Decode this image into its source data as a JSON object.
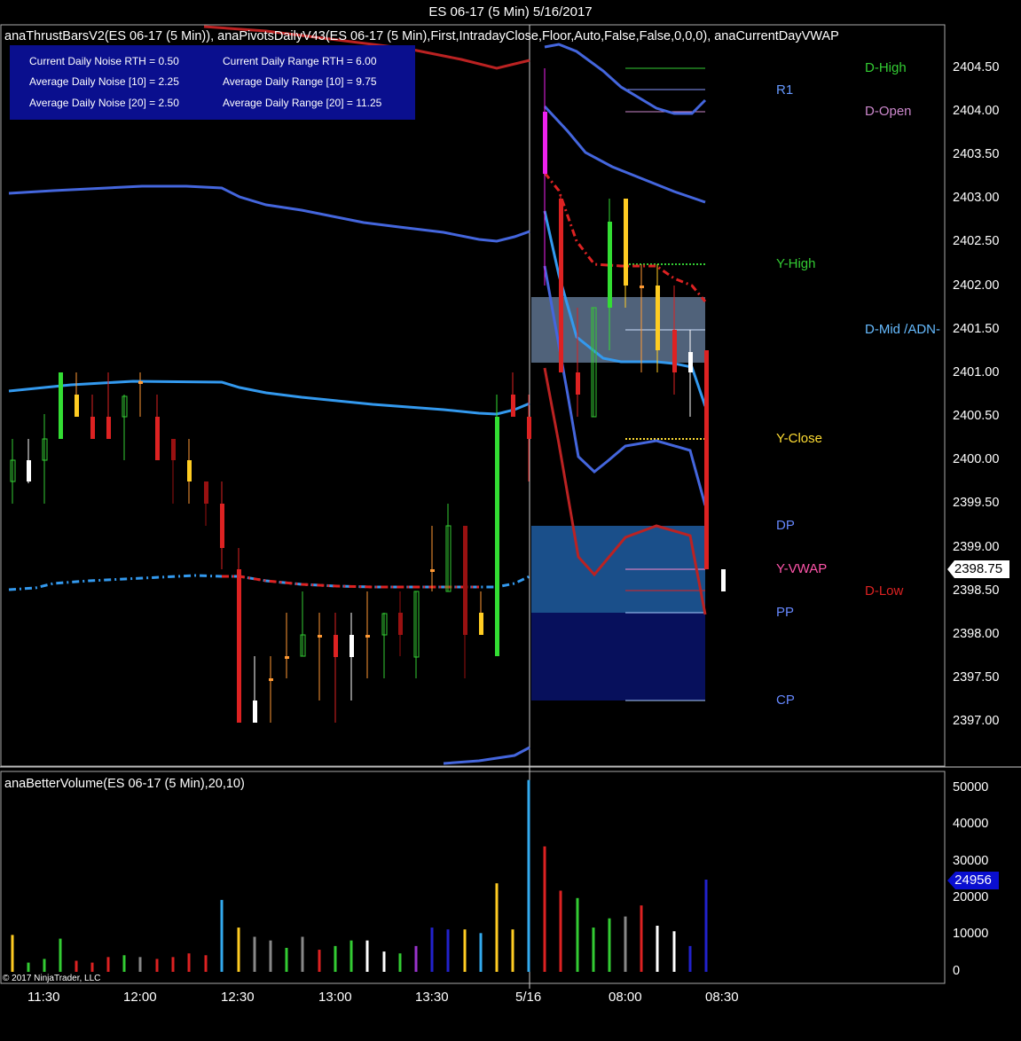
{
  "window": {
    "title": "ES 06-17 (5 Min)  5/16/2017"
  },
  "price_panel": {
    "indicator_label": "anaThrustBarsV2(ES 06-17  (5 Min)),  anaPivotsDailyV43(ES 06-17  (5 Min),First,IntradayClose,Floor,Auto,False,False,0,0,0),  anaCurrentDayVWAP",
    "stats": {
      "noise_rth": "Current Daily Noise RTH = 0.50",
      "range_rth": "Current Daily Range RTH = 6.00",
      "noise_10": "Average Daily Noise [10] = 2.25",
      "range_10": "Average Daily Range [10] = 9.75",
      "noise_20": "Average Daily Noise [20] = 2.50",
      "range_20": "Average Daily Range [20] = 11.25"
    },
    "price_axis": [
      "2404.50",
      "2404.00",
      "2403.50",
      "2403.00",
      "2402.50",
      "2402.00",
      "2401.50",
      "2401.00",
      "2400.50",
      "2400.00",
      "2399.50",
      "2399.00",
      "2398.50",
      "2398.00",
      "2397.50",
      "2397.00"
    ],
    "last_price": "2398.75",
    "levels": {
      "d_high": "D-High",
      "r1": "R1",
      "d_open": "D-Open",
      "y_high": "Y-High",
      "d_mid": "D-Mid /ADN-",
      "y_close": "Y-Close",
      "dp": "DP",
      "y_vwap": "Y-VWAP",
      "d_low": "D-Low",
      "pp": "PP",
      "cp": "CP"
    },
    "colors": {
      "d_high": "#33cc33",
      "r1": "#6699ff",
      "d_open": "#cc88cc",
      "y_high": "#33cc33",
      "d_mid": "#66bbff",
      "y_close": "#ffdd33",
      "dp": "#6688ff",
      "y_vwap": "#ff55aa",
      "d_low": "#dd2222",
      "pp": "#6688ff",
      "cp": "#6688ff"
    }
  },
  "volume_panel": {
    "indicator_label": "anaBetterVolume(ES 06-17 (5 Min),20,10)",
    "volume_axis": [
      "50000",
      "40000",
      "30000",
      "20000",
      "10000",
      "0"
    ],
    "last_volume": "24956"
  },
  "time_axis": [
    "11:30",
    "12:00",
    "12:30",
    "13:00",
    "13:30",
    "5/16",
    "08:00",
    "08:30"
  ],
  "copyright": "© 2017 NinjaTrader, LLC",
  "chart_data": {
    "type": "candlestick",
    "volume_values": [
      10000,
      2500,
      3500,
      9000,
      3000,
      2500,
      4000,
      4500,
      4000,
      3500,
      4000,
      5000,
      4500,
      19500,
      12000,
      9500,
      8500,
      6500,
      9500,
      6000,
      7000,
      8500,
      8500,
      5500,
      5000,
      7000,
      12000,
      11500,
      11500,
      10500,
      24000,
      11500,
      52000,
      34000,
      22000,
      20000,
      12000,
      14500,
      15000,
      18000,
      12500,
      11000,
      7000,
      25000
    ],
    "last_price": 2398.75,
    "last_volume": 24956
  }
}
